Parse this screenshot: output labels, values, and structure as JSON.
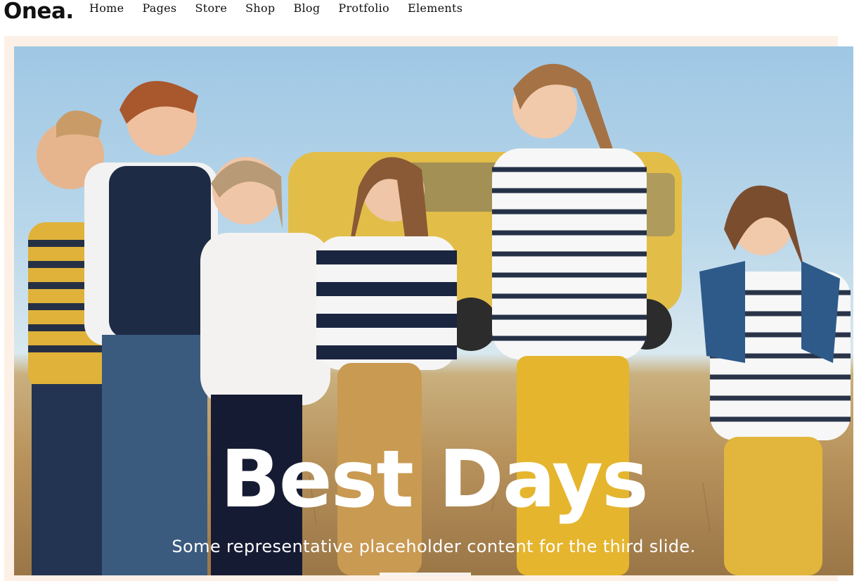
{
  "header": {
    "logo": "Onea.",
    "nav": [
      "Home",
      "Pages",
      "Store",
      "Shop",
      "Blog",
      "Protfolio",
      "Elements"
    ]
  },
  "hero": {
    "title": "Best Days",
    "caption": "Some representative placeholder content for the third slide.",
    "image": "photo-of-children-holding-hands-in-field"
  },
  "colors": {
    "frame": "#fdf0e6",
    "text_dark": "#111111",
    "overlay_text": "#ffffff"
  }
}
